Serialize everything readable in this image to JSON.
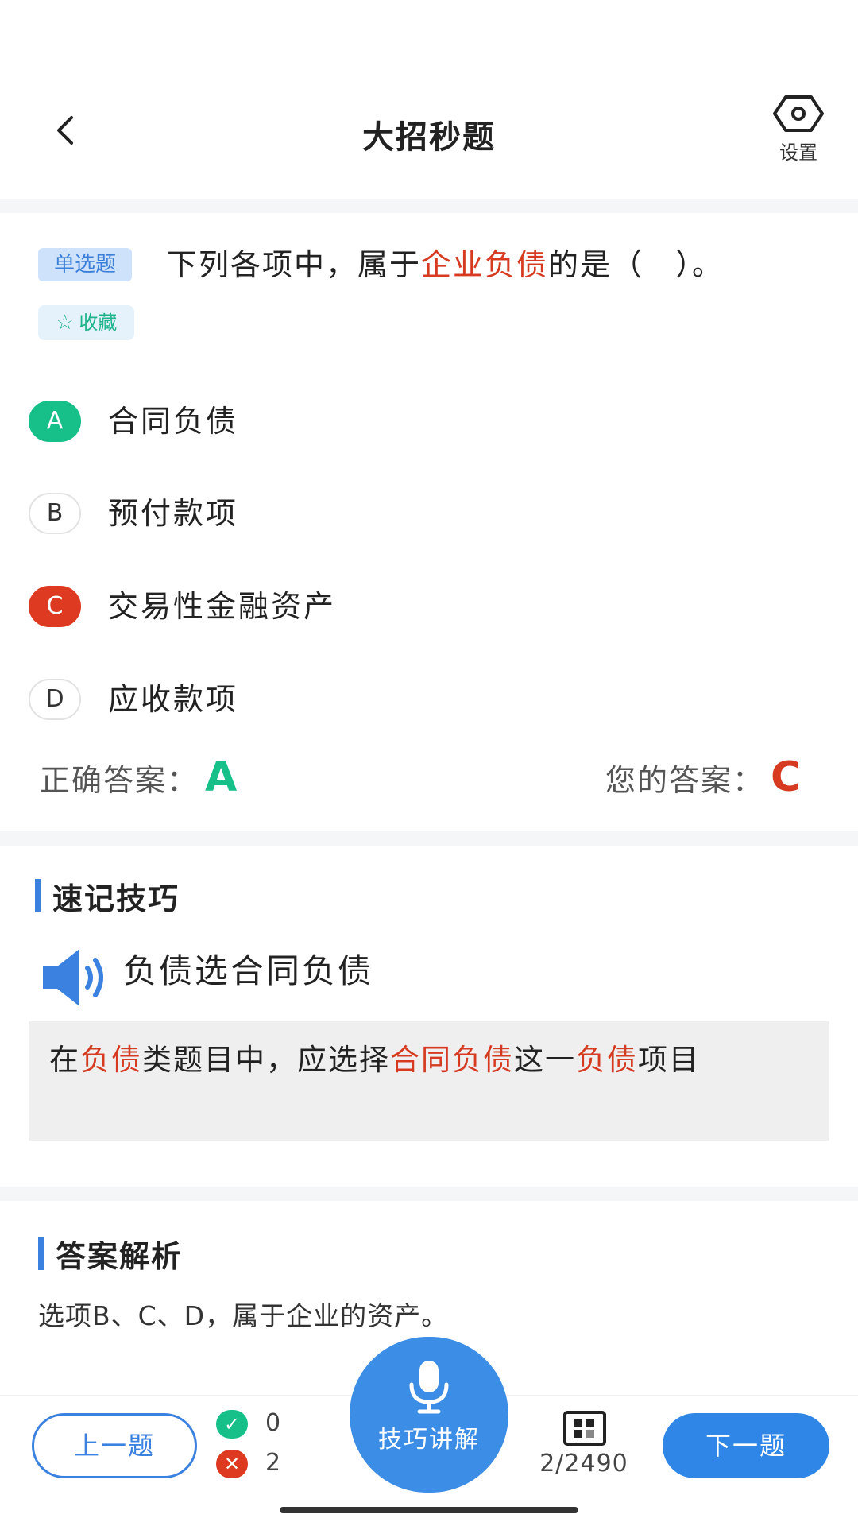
{
  "header": {
    "title": "大招秒题",
    "settings_label": "设置"
  },
  "question": {
    "type_badge": "单选题",
    "text_before": "下列各项中，属于",
    "text_highlight": "企业负债",
    "text_after": "的是（　）。",
    "favorite_label": "收藏",
    "options": [
      {
        "letter": "A",
        "text": "合同负债",
        "state": "correct"
      },
      {
        "letter": "B",
        "text": "预付款项",
        "state": "normal"
      },
      {
        "letter": "C",
        "text": "交易性金融资产",
        "state": "wrong"
      },
      {
        "letter": "D",
        "text": "应收款项",
        "state": "normal"
      }
    ],
    "correct_answer_label": "正确答案：",
    "correct_answer": "A",
    "your_answer_label": "您的答案：",
    "your_answer": "C"
  },
  "tip": {
    "section_title": "速记技巧",
    "headline": "负债选合同负债",
    "body": [
      {
        "text": "在",
        "highlight": false
      },
      {
        "text": "负债",
        "highlight": true
      },
      {
        "text": "类题目中，应选择",
        "highlight": false
      },
      {
        "text": "合同负债",
        "highlight": true
      },
      {
        "text": "这一",
        "highlight": false
      },
      {
        "text": "负债",
        "highlight": true
      },
      {
        "text": "项目",
        "highlight": false
      }
    ]
  },
  "analysis": {
    "section_title": "答案解析",
    "text": "选项B、C、D，属于企业的资产。"
  },
  "bottom": {
    "prev_label": "上一题",
    "correct_count": "0",
    "wrong_count": "2",
    "mic_label": "技巧讲解",
    "progress": "2/2490",
    "next_label": "下一题"
  },
  "colors": {
    "accent_blue": "#3b82e0",
    "correct_green": "#16c088",
    "wrong_red": "#de3a22",
    "highlight_red": "#d63b22"
  },
  "icons": {
    "back": "chevron-left-icon",
    "settings": "hexagon-gear-icon",
    "favorite": "star-outline-icon",
    "speaker": "speaker-icon",
    "mic": "microphone-icon",
    "grid": "grid-icon",
    "check": "check-icon",
    "cross": "close-icon"
  }
}
